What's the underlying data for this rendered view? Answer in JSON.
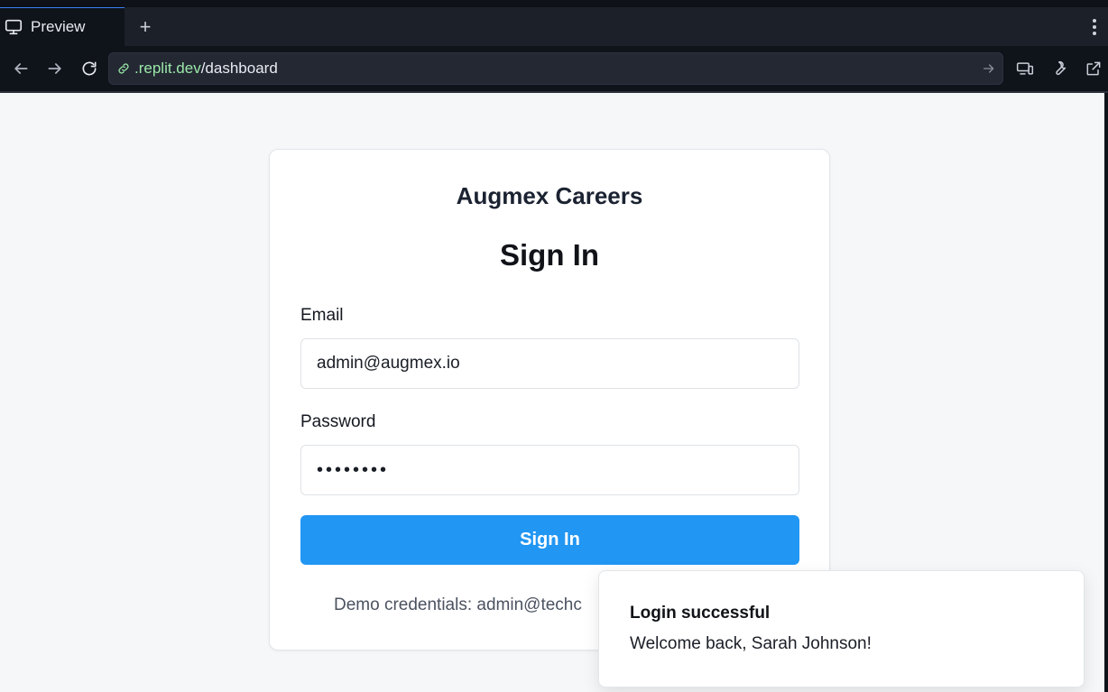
{
  "browser": {
    "tab_label": "Preview",
    "new_tab_symbol": "+",
    "url_host": ".replit.dev",
    "url_path": "/dashboard",
    "icons": [
      "monitor-icon",
      "plus-icon",
      "kebab-menu-icon",
      "back-arrow-icon",
      "forward-arrow-icon",
      "reload-icon",
      "link-icon",
      "go-arrow-icon",
      "devices-icon",
      "wrench-icon",
      "external-link-icon"
    ]
  },
  "login": {
    "brand": "Augmex Careers",
    "title": "Sign In",
    "email_label": "Email",
    "email_value": "admin@augmex.io",
    "password_label": "Password",
    "password_masked": "••••••••",
    "submit_label": "Sign In",
    "demo_text": "Demo credentials: admin@techc"
  },
  "toast": {
    "title": "Login successful",
    "message": "Welcome back, Sarah Johnson!"
  },
  "colors": {
    "primary_button": "#2196f3",
    "url_host": "#9be7a8",
    "chrome_dark": "#0f131a",
    "page_bg": "#f6f7f9"
  }
}
